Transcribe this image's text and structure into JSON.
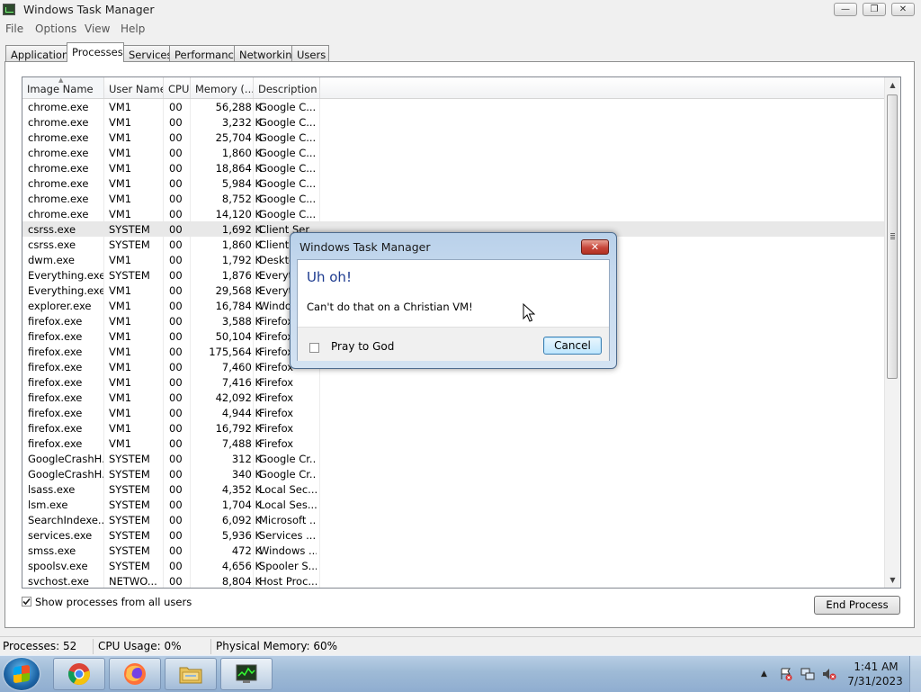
{
  "window": {
    "title": "Windows Task Manager",
    "minimize": "—",
    "maximize": "❐",
    "close": "✕"
  },
  "menu": [
    "File",
    "Options",
    "View",
    "Help"
  ],
  "tabs": [
    "Applications",
    "Processes",
    "Services",
    "Performance",
    "Networking",
    "Users"
  ],
  "active_tab": "Processes",
  "columns": [
    "Image Name",
    "User Name",
    "CPU",
    "Memory (...",
    "Description"
  ],
  "processes": [
    {
      "name": "chrome.exe",
      "user": "VM1",
      "cpu": "00",
      "mem": "56,288 K",
      "desc": "Google C..."
    },
    {
      "name": "chrome.exe",
      "user": "VM1",
      "cpu": "00",
      "mem": "3,232 K",
      "desc": "Google C..."
    },
    {
      "name": "chrome.exe",
      "user": "VM1",
      "cpu": "00",
      "mem": "25,704 K",
      "desc": "Google C..."
    },
    {
      "name": "chrome.exe",
      "user": "VM1",
      "cpu": "00",
      "mem": "1,860 K",
      "desc": "Google C..."
    },
    {
      "name": "chrome.exe",
      "user": "VM1",
      "cpu": "00",
      "mem": "18,864 K",
      "desc": "Google C..."
    },
    {
      "name": "chrome.exe",
      "user": "VM1",
      "cpu": "00",
      "mem": "5,984 K",
      "desc": "Google C..."
    },
    {
      "name": "chrome.exe",
      "user": "VM1",
      "cpu": "00",
      "mem": "8,752 K",
      "desc": "Google C..."
    },
    {
      "name": "chrome.exe",
      "user": "VM1",
      "cpu": "00",
      "mem": "14,120 K",
      "desc": "Google C..."
    },
    {
      "name": "csrss.exe",
      "user": "SYSTEM",
      "cpu": "00",
      "mem": "1,692 K",
      "desc": "Client Ser",
      "selected": true
    },
    {
      "name": "csrss.exe",
      "user": "SYSTEM",
      "cpu": "00",
      "mem": "1,860 K",
      "desc": "Client S"
    },
    {
      "name": "dwm.exe",
      "user": "VM1",
      "cpu": "00",
      "mem": "1,792 K",
      "desc": "Deskto"
    },
    {
      "name": "Everything.exe",
      "user": "SYSTEM",
      "cpu": "00",
      "mem": "1,876 K",
      "desc": "Everyth"
    },
    {
      "name": "Everything.exe",
      "user": "VM1",
      "cpu": "00",
      "mem": "29,568 K",
      "desc": "Everyth"
    },
    {
      "name": "explorer.exe",
      "user": "VM1",
      "cpu": "00",
      "mem": "16,784 K",
      "desc": "Window"
    },
    {
      "name": "firefox.exe",
      "user": "VM1",
      "cpu": "00",
      "mem": "3,588 K",
      "desc": "Firefox"
    },
    {
      "name": "firefox.exe",
      "user": "VM1",
      "cpu": "00",
      "mem": "50,104 K",
      "desc": "Firefox"
    },
    {
      "name": "firefox.exe",
      "user": "VM1",
      "cpu": "00",
      "mem": "175,564 K",
      "desc": "Firefox"
    },
    {
      "name": "firefox.exe",
      "user": "VM1",
      "cpu": "00",
      "mem": "7,460 K",
      "desc": "Firefox"
    },
    {
      "name": "firefox.exe",
      "user": "VM1",
      "cpu": "00",
      "mem": "7,416 K",
      "desc": "Firefox"
    },
    {
      "name": "firefox.exe",
      "user": "VM1",
      "cpu": "00",
      "mem": "42,092 K",
      "desc": "Firefox"
    },
    {
      "name": "firefox.exe",
      "user": "VM1",
      "cpu": "00",
      "mem": "4,944 K",
      "desc": "Firefox"
    },
    {
      "name": "firefox.exe",
      "user": "VM1",
      "cpu": "00",
      "mem": "16,792 K",
      "desc": "Firefox"
    },
    {
      "name": "firefox.exe",
      "user": "VM1",
      "cpu": "00",
      "mem": "7,488 K",
      "desc": "Firefox"
    },
    {
      "name": "GoogleCrashH...",
      "user": "SYSTEM",
      "cpu": "00",
      "mem": "312 K",
      "desc": "Google Cr..."
    },
    {
      "name": "GoogleCrashH...",
      "user": "SYSTEM",
      "cpu": "00",
      "mem": "340 K",
      "desc": "Google Cr..."
    },
    {
      "name": "lsass.exe",
      "user": "SYSTEM",
      "cpu": "00",
      "mem": "4,352 K",
      "desc": "Local Sec..."
    },
    {
      "name": "lsm.exe",
      "user": "SYSTEM",
      "cpu": "00",
      "mem": "1,704 K",
      "desc": "Local Ses..."
    },
    {
      "name": "SearchIndexe...",
      "user": "SYSTEM",
      "cpu": "00",
      "mem": "6,092 K",
      "desc": "Microsoft ..."
    },
    {
      "name": "services.exe",
      "user": "SYSTEM",
      "cpu": "00",
      "mem": "5,936 K",
      "desc": "Services ..."
    },
    {
      "name": "smss.exe",
      "user": "SYSTEM",
      "cpu": "00",
      "mem": "472 K",
      "desc": "Windows ..."
    },
    {
      "name": "spoolsv.exe",
      "user": "SYSTEM",
      "cpu": "00",
      "mem": "4,656 K",
      "desc": "Spooler S..."
    },
    {
      "name": "svchost.exe",
      "user": "NETWO...",
      "cpu": "00",
      "mem": "8,804 K",
      "desc": "Host Proc..."
    }
  ],
  "show_all_users": {
    "label": "Show processes from all users",
    "checked": true
  },
  "end_process_label": "End Process",
  "status": {
    "processes": "Processes: 52",
    "cpu": "CPU Usage: 0%",
    "memory": "Physical Memory: 60%"
  },
  "dialog": {
    "title": "Windows Task Manager",
    "close": "✕",
    "heading": "Uh oh!",
    "message": "Can't do that on a Christian VM!",
    "checkbox_label": "Pray to God",
    "checkbox_checked": false,
    "cancel_label": "Cancel"
  },
  "taskbar": {
    "apps": [
      "chrome-icon",
      "firefox-icon",
      "explorer-folder-icon",
      "task-manager-icon"
    ],
    "tray_icons": [
      "show-hidden-icons",
      "action-center-icon",
      "network-icon",
      "volume-muted-icon"
    ],
    "tray_arrow": "▲",
    "time": "1:41 AM",
    "date": "7/31/2023"
  },
  "colors": {
    "dialog_heading": "#1c3a8f",
    "dialog_close": "#c7463a",
    "taskbar": "#9ebad6"
  }
}
